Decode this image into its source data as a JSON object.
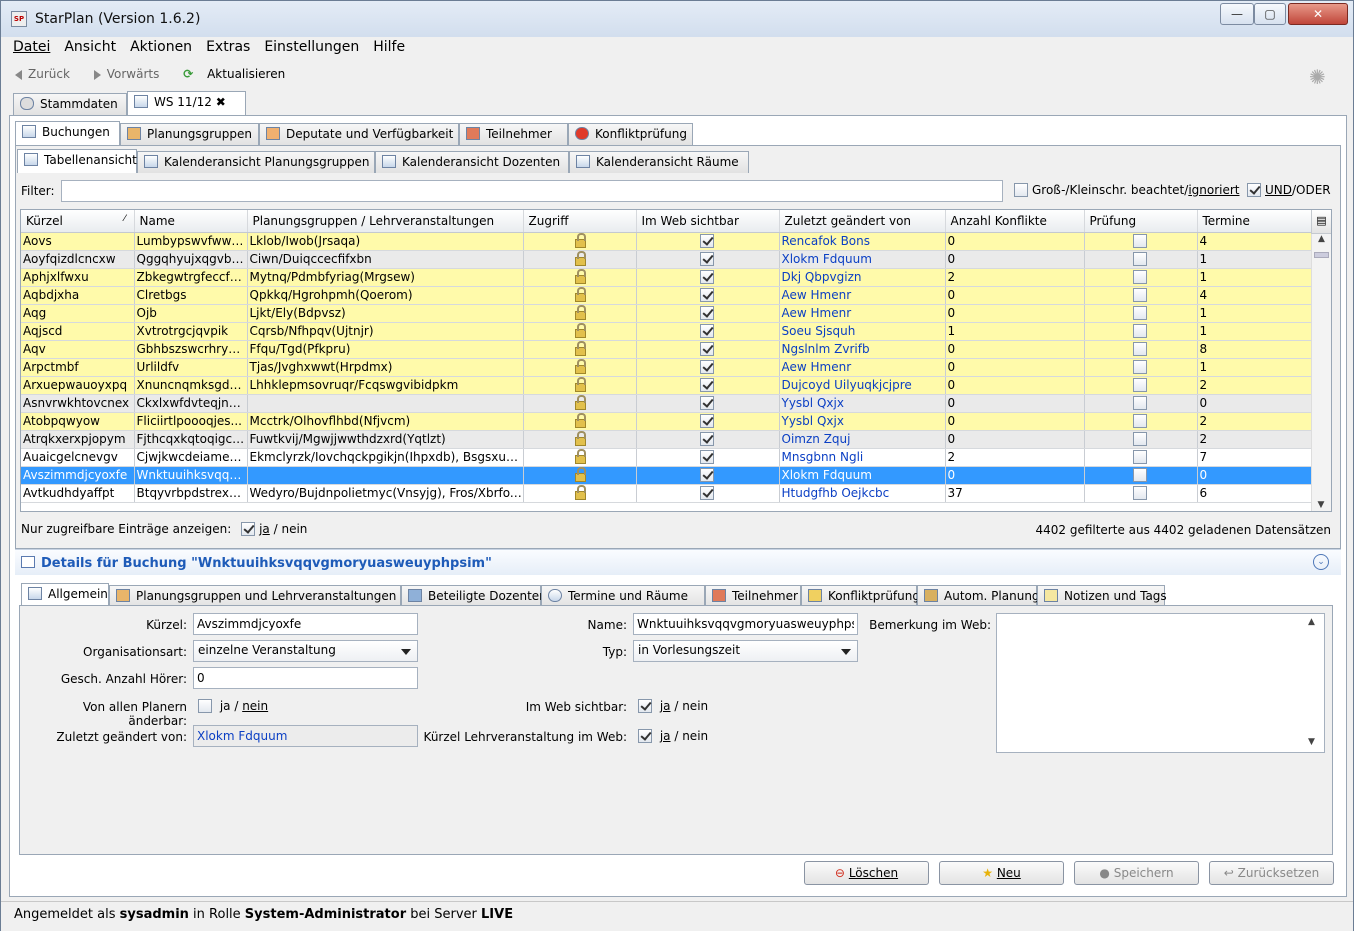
{
  "window": {
    "title": "StarPlan (Version 1.6.2)",
    "app_icon": "SP"
  },
  "menu": [
    "Datei",
    "Ansicht",
    "Aktionen",
    "Extras",
    "Einstellungen",
    "Hilfe"
  ],
  "nav": {
    "back": "Zurück",
    "forward": "Vorwärts",
    "refresh": "Aktualisieren"
  },
  "doc_tabs": [
    "Stammdaten",
    "WS 11/12"
  ],
  "main_tabs": [
    "Buchungen",
    "Planungsgruppen",
    "Deputate und Verfügbarkeit",
    "Teilnehmer",
    "Konfliktprüfung"
  ],
  "view_tabs": [
    "Tabellenansicht",
    "Kalenderansicht Planungsgruppen",
    "Kalenderansicht Dozenten",
    "Kalenderansicht Räume"
  ],
  "filter": {
    "label": "Filter:",
    "value": "",
    "case_label": "Groß-/Kleinschr. beachtet/",
    "case_link": "ignoriert",
    "andor_label_a": "UND",
    "andor_label_b": "/ODER"
  },
  "table": {
    "columns": [
      "Kürzel",
      "Name",
      "Planungsgruppen / Lehrveranstaltungen",
      "Zugriff",
      "Im Web sichtbar",
      "Zuletzt geändert von",
      "Anzahl Konflikte",
      "Prüfung",
      "Termine"
    ],
    "rows": [
      {
        "k": "Aovs",
        "n": "Lumbypswvfwwvt...",
        "p": "Lklob/Iwob(Jrsaqa)",
        "z": "Rencafok Bons",
        "a": "0",
        "t": "4",
        "c": "y"
      },
      {
        "k": "Aoyfqizdlcncxw",
        "n": "Qggqhyujxqgvbyj...",
        "p": "Ciwn/Duiqccecfifxbn",
        "z": "Xlokm Fdquum",
        "a": "0",
        "t": "1",
        "c": "g"
      },
      {
        "k": "Aphjxlfwxu",
        "n": "Zbkegwtrgfeccfo...",
        "p": "Mytnq/Pdmbfyriag(Mrgsew)",
        "z": "Dkj Qbpvgizn",
        "a": "2",
        "t": "1",
        "c": "y"
      },
      {
        "k": "Aqbdjxha",
        "n": "Clretbgs",
        "p": "Qpkkq/Hgrohpmh(Qoerom)",
        "z": "Aew Hmenr",
        "a": "0",
        "t": "4",
        "c": "y"
      },
      {
        "k": "Aqg",
        "n": "Ojb",
        "p": "Ljkt/Ely(Bdpvsz)",
        "z": "Aew Hmenr",
        "a": "0",
        "t": "1",
        "c": "y"
      },
      {
        "k": "Aqjscd",
        "n": "Xvtrotrgcjqvpik",
        "p": "Cqrsb/Nfhpqv(Ujtnjr)",
        "z": "Soeu Sjsquh",
        "a": "1",
        "t": "1",
        "c": "y"
      },
      {
        "k": "Aqv",
        "n": "Gbhbszswcrhryb...",
        "p": "Ffqu/Tgd(Pfkpru)",
        "z": "Ngslnlm Zvrifb",
        "a": "0",
        "t": "8",
        "c": "y"
      },
      {
        "k": "Arpctmbf",
        "n": "Urlildfv",
        "p": "Tjas/Jvghxwwt(Hrpdmx)",
        "z": "Aew Hmenr",
        "a": "0",
        "t": "1",
        "c": "y"
      },
      {
        "k": "Arxuepwauoyxpq",
        "n": "Xnuncnqmksgdys...",
        "p": "Lhhklepmsovruqr/Fcqswgvibidpkm",
        "z": "Dujcoyd Uilyuqkjcjpre",
        "a": "0",
        "t": "2",
        "c": "y"
      },
      {
        "k": "Asnvrwkhtovcnex",
        "n": "Ckxlxwfdvteqjncp...",
        "p": "",
        "z": "Yysbl Qxjx",
        "a": "0",
        "t": "0",
        "c": "g"
      },
      {
        "k": "Atobpqwyow",
        "n": "Fliciirtlpoooqjes...",
        "p": "Mcctrk/Olhovflhbd(Nfjvcm)",
        "z": "Yysbl Qxjx",
        "a": "0",
        "t": "2",
        "c": "y"
      },
      {
        "k": "Atrqkxerxpjopym",
        "n": "Fjthcqxkqtoqigcb...",
        "p": "Fuwtkvij/Mgwjjwwthdzxrd(Yqtlzt)",
        "z": "Oimzn Zquj",
        "a": "0",
        "t": "2",
        "c": "g"
      },
      {
        "k": "Auaicgelcnevgv",
        "n": "Cjwjkwcdeiamed...",
        "p": "Ekmclyrzk/Iovchqckpgikjn(Ihpxdb), Bsgsxuqve...",
        "z": "Mnsgbnn Ngli",
        "a": "2",
        "t": "7",
        "c": "w"
      },
      {
        "k": "Avszimmdjcyoxfe",
        "n": "Wnktuuihksvqqvg...",
        "p": "",
        "z": "Xlokm Fdquum",
        "a": "0",
        "t": "0",
        "c": "sel"
      },
      {
        "k": "Avtkudhdyaffpt",
        "n": "Btqyvrbpdstrexqd...",
        "p": "Wedyro/Bujdnpolietmyc(Vnsyjg), Fros/Xbrfox...",
        "z": "Htudgfhb Oejkcbc",
        "a": "37",
        "t": "6",
        "c": "w"
      }
    ]
  },
  "only_accessible": {
    "label": "Nur zugreifbare Einträge anzeigen:",
    "yes": "ja",
    "no": "/ nein"
  },
  "record_count": "4402 gefilterte aus 4402 geladenen Datensätzen",
  "details": {
    "title": "Details für Buchung \"Wnktuuihksvqqvgmoryuasweuyphpsim\"",
    "tabs": [
      "Allgemein",
      "Planungsgruppen und Lehrveranstaltungen",
      "Beteiligte Dozenten",
      "Termine und Räume",
      "Teilnehmer",
      "Konfliktprüfung",
      "Autom. Planung",
      "Notizen und Tags"
    ],
    "kuerzel_label": "Kürzel:",
    "kuerzel": "Avszimmdjcyoxfe",
    "org_label": "Organisationsart:",
    "org": "einzelne Veranstaltung",
    "hoerer_label": "Gesch. Anzahl Hörer:",
    "hoerer": "0",
    "aenderbar_label": "Von allen Planern änderbar:",
    "aenderbar_yes": "ja",
    "aenderbar_no": "nein",
    "geaendert_label": "Zuletzt geändert von:",
    "geaendert": "Xlokm Fdquum",
    "name_label": "Name:",
    "name": "Wnktuuihksvqqvgmoryuasweuyphpsim",
    "typ_label": "Typ:",
    "typ": "in Vorlesungszeit",
    "web_label": "Im Web sichtbar:",
    "web_yes": "ja",
    "web_no": "/ nein",
    "lv_web_label": "Kürzel Lehrveranstaltung im Web:",
    "lv_yes": "ja",
    "lv_no": "/ nein",
    "bemerkung_label": "Bemerkung im Web:",
    "bemerkung": ""
  },
  "buttons": {
    "delete": "Löschen",
    "new": "Neu",
    "save": "Speichern",
    "reset": "Zurücksetzen"
  },
  "status": {
    "prefix": "Angemeldet als ",
    "user": "sysadmin",
    "mid": " in Rolle ",
    "role": "System-Administrator",
    "mid2": " bei Server ",
    "server": "LIVE"
  },
  "colors": {
    "row_yellow": "#fffaaa",
    "selection": "#3399ff",
    "link": "#0b3fc4"
  }
}
